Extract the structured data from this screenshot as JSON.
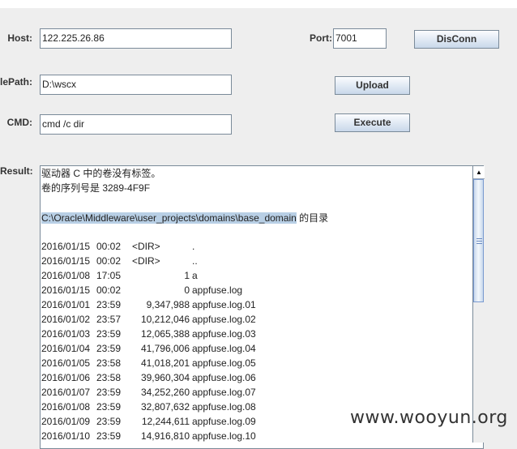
{
  "form": {
    "host_label": "Host:",
    "host_value": "122.225.26.86",
    "port_label": "Port:",
    "port_value": "7001",
    "disconn_label": "DisConn",
    "filepath_label": "lePath:",
    "filepath_value": "D:\\wscx",
    "upload_label": "Upload",
    "cmd_label": "CMD:",
    "cmd_value": "cmd /c dir",
    "execute_label": "Execute",
    "result_label": "Result:"
  },
  "result": {
    "header1": "驱动器 C 中的卷没有标签。",
    "header2": "卷的序列号是 3289-4F9F",
    "dir_path": "C:\\Oracle\\Middleware\\user_projects\\domains\\base_domain",
    "dir_suffix": " 的目录",
    "rows": [
      {
        "date": "2016/01/15",
        "time": "00:02",
        "type": "<DIR>",
        "size": "",
        "name": "."
      },
      {
        "date": "2016/01/15",
        "time": "00:02",
        "type": "<DIR>",
        "size": "",
        "name": ".."
      },
      {
        "date": "2016/01/08",
        "time": "17:05",
        "type": "",
        "size": "1",
        "name": "a"
      },
      {
        "date": "2016/01/15",
        "time": "00:02",
        "type": "",
        "size": "0",
        "name": "appfuse.log"
      },
      {
        "date": "2016/01/01",
        "time": "23:59",
        "type": "",
        "size": "9,347,988",
        "name": "appfuse.log.01"
      },
      {
        "date": "2016/01/02",
        "time": "23:57",
        "type": "",
        "size": "10,212,046",
        "name": "appfuse.log.02"
      },
      {
        "date": "2016/01/03",
        "time": "23:59",
        "type": "",
        "size": "12,065,388",
        "name": "appfuse.log.03"
      },
      {
        "date": "2016/01/04",
        "time": "23:59",
        "type": "",
        "size": "41,796,006",
        "name": "appfuse.log.04"
      },
      {
        "date": "2016/01/05",
        "time": "23:58",
        "type": "",
        "size": "41,018,201",
        "name": "appfuse.log.05"
      },
      {
        "date": "2016/01/06",
        "time": "23:58",
        "type": "",
        "size": "39,960,304",
        "name": "appfuse.log.06"
      },
      {
        "date": "2016/01/07",
        "time": "23:59",
        "type": "",
        "size": "34,252,260",
        "name": "appfuse.log.07"
      },
      {
        "date": "2016/01/08",
        "time": "23:59",
        "type": "",
        "size": "32,807,632",
        "name": "appfuse.log.08"
      },
      {
        "date": "2016/01/09",
        "time": "23:59",
        "type": "",
        "size": "12,244,611",
        "name": "appfuse.log.09"
      },
      {
        "date": "2016/01/10",
        "time": "23:59",
        "type": "",
        "size": "14,916,810",
        "name": "appfuse.log.10"
      }
    ],
    "scroll_fraction": 0
  },
  "watermark": "www.wooyun.org"
}
